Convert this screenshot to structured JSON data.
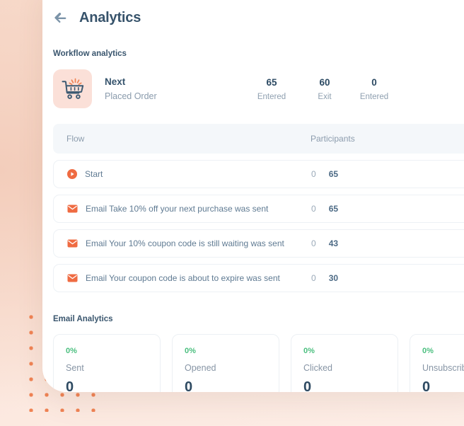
{
  "header": {
    "back_icon": "arrow-left-icon",
    "title": "Analytics"
  },
  "workflow_analytics": {
    "section_title": "Workflow analytics",
    "summary": {
      "icon": "shopping-cart-icon",
      "name": "Next",
      "subtitle": "Placed Order",
      "stats": [
        {
          "value": "65",
          "label": "Entered"
        },
        {
          "value": "60",
          "label": "Exit"
        },
        {
          "value": "0",
          "label": "Entered"
        }
      ]
    },
    "table": {
      "columns": {
        "flow": "Flow",
        "participants": "Participants"
      },
      "rows": [
        {
          "icon": "play-circle-icon",
          "label": "Start",
          "zero": "0",
          "count": "65"
        },
        {
          "icon": "envelope-icon",
          "label": "Email Take 10% off your next purchase was sent",
          "zero": "0",
          "count": "65"
        },
        {
          "icon": "envelope-icon",
          "label": "Email Your 10% coupon code is still waiting was sent",
          "zero": "0",
          "count": "43"
        },
        {
          "icon": "envelope-icon",
          "label": "Email Your coupon code is about to expire was sent",
          "zero": "0",
          "count": "30"
        }
      ]
    }
  },
  "email_analytics": {
    "section_title": "Email Analytics",
    "cards": [
      {
        "percent": "0%",
        "label": "Sent",
        "value": "0"
      },
      {
        "percent": "0%",
        "label": "Opened",
        "value": "0"
      },
      {
        "percent": "0%",
        "label": "Clicked",
        "value": "0"
      },
      {
        "percent": "0%",
        "label": "Unsubscribed",
        "value": "0"
      }
    ]
  },
  "colors": {
    "accent_orange": "#ef8354",
    "title_slate": "#37536b",
    "green": "#4bbf7f",
    "panel_bg": "#ffffff",
    "page_bg": "#fbe6dc"
  }
}
